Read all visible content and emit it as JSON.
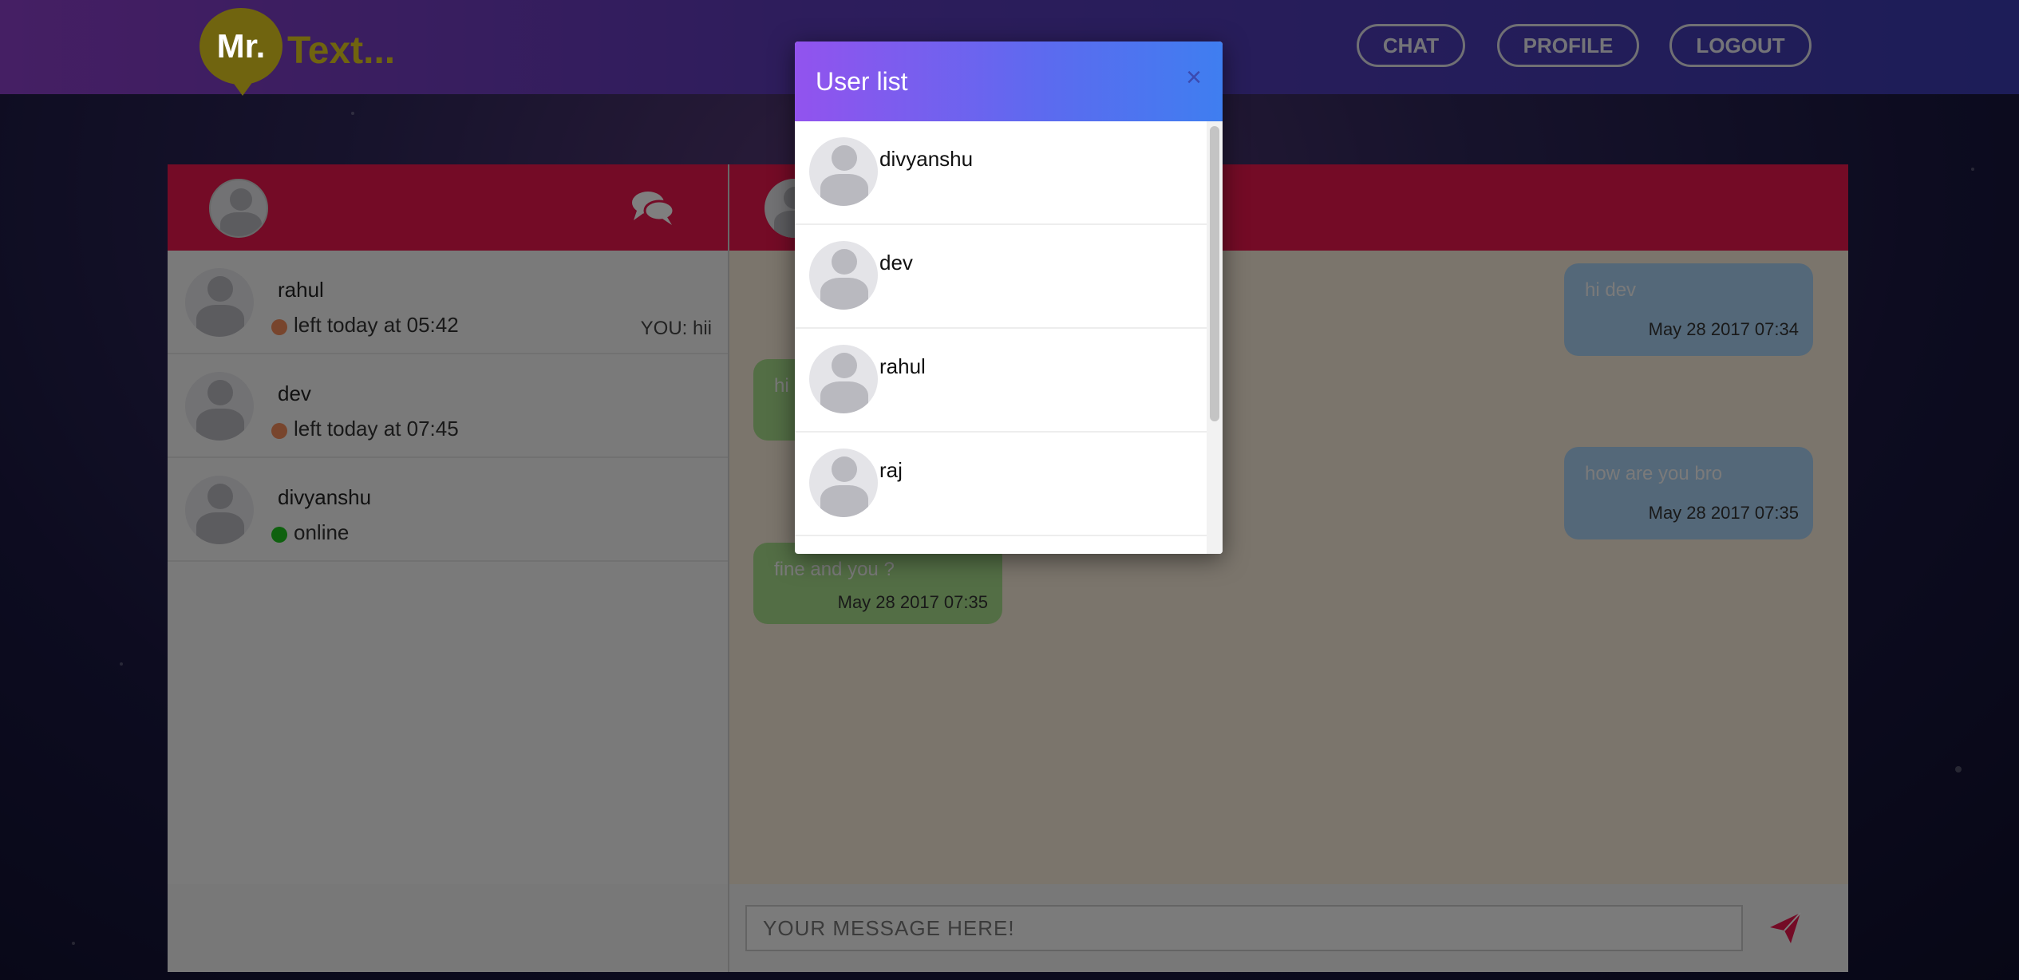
{
  "header": {
    "logo_mr": "Mr.",
    "logo_text": "Text...",
    "nav": {
      "chat": "CHAT",
      "profile": "PROFILE",
      "logout": "LOGOUT"
    }
  },
  "conversations": [
    {
      "name": "rahul",
      "status": "left today at 05:42",
      "status_color": "#f08a5a",
      "last_message": "YOU: hii"
    },
    {
      "name": "dev",
      "status": "left today at 07:45",
      "status_color": "#f08a5a",
      "last_message": ""
    },
    {
      "name": "divyanshu",
      "status": "online",
      "status_color": "#1ec31e",
      "last_message": ""
    }
  ],
  "messages": [
    {
      "direction": "out",
      "text": "hi dev",
      "time": "May 28 2017 07:34"
    },
    {
      "direction": "in",
      "text": "hi",
      "time": ""
    },
    {
      "direction": "out",
      "text": "how are you bro",
      "time": "May 28 2017 07:35"
    },
    {
      "direction": "in",
      "text": "fine and you ?",
      "time": "May 28 2017 07:35"
    }
  ],
  "composer": {
    "placeholder": "YOUR MESSAGE HERE!"
  },
  "modal": {
    "title": "User list",
    "close": "×",
    "users": [
      "divyanshu",
      "dev",
      "rahul",
      "raj"
    ]
  },
  "colors": {
    "accent": "#e8174d",
    "online": "#1ec31e",
    "offline": "#f08a5a",
    "outgoing_bubble": "#a8d0f2",
    "incoming_bubble": "#a6dd8a"
  }
}
